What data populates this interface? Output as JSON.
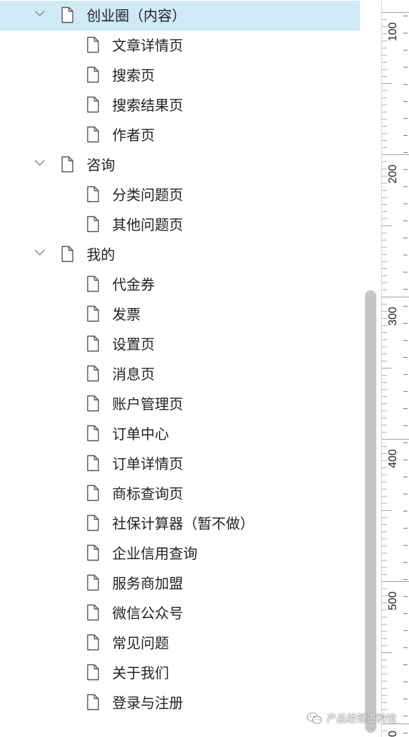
{
  "tree": {
    "rows": [
      {
        "level": 1,
        "label": "创业圈（内容）",
        "expanded": true,
        "selected": true
      },
      {
        "level": 2,
        "label": "文章详情页"
      },
      {
        "level": 2,
        "label": "搜索页"
      },
      {
        "level": 2,
        "label": "搜索结果页"
      },
      {
        "level": 2,
        "label": "作者页"
      },
      {
        "level": 1,
        "label": "咨询",
        "expanded": true
      },
      {
        "level": 2,
        "label": "分类问题页"
      },
      {
        "level": 2,
        "label": "其他问题页"
      },
      {
        "level": 1,
        "label": "我的",
        "expanded": true
      },
      {
        "level": 2,
        "label": "代金券"
      },
      {
        "level": 2,
        "label": "发票"
      },
      {
        "level": 2,
        "label": "设置页"
      },
      {
        "level": 2,
        "label": "消息页"
      },
      {
        "level": 2,
        "label": "账户管理页"
      },
      {
        "level": 2,
        "label": "订单中心"
      },
      {
        "level": 2,
        "label": "订单详情页"
      },
      {
        "level": 2,
        "label": "商标查询页"
      },
      {
        "level": 2,
        "label": "社保计算器（暂不做）"
      },
      {
        "level": 2,
        "label": "企业信用查询"
      },
      {
        "level": 2,
        "label": "服务商加盟"
      },
      {
        "level": 2,
        "label": "微信公众号"
      },
      {
        "level": 2,
        "label": "常见问题"
      },
      {
        "level": 2,
        "label": "关于我们"
      },
      {
        "level": 2,
        "label": "登录与注册"
      }
    ]
  },
  "ruler": {
    "labels": [
      "100",
      "200",
      "300",
      "400",
      "500",
      "0"
    ]
  },
  "watermark": {
    "text": "产品经理资料馆",
    "icon": "wechat-logo-icon"
  },
  "colors": {
    "selected_row": "#cfeaf5",
    "scroll_thumb": "#c6c6c6",
    "ruler_accent": "#6b6fd8"
  }
}
